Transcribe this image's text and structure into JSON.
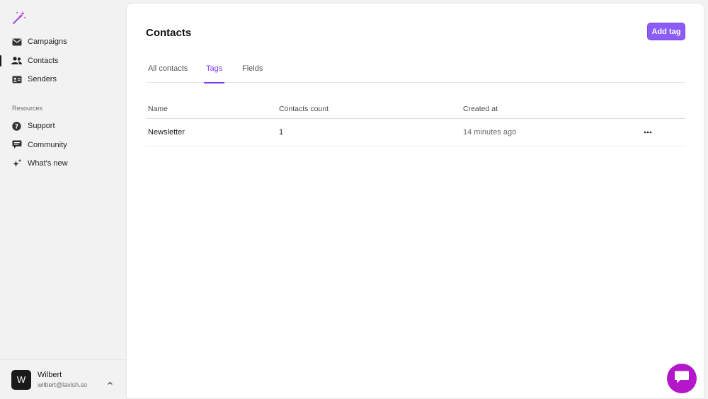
{
  "sidebar": {
    "items": [
      {
        "label": "Campaigns",
        "icon": "envelope-icon"
      },
      {
        "label": "Contacts",
        "icon": "users-icon",
        "active": true
      },
      {
        "label": "Senders",
        "icon": "id-card-icon"
      }
    ],
    "resources_label": "Resources",
    "resources": [
      {
        "label": "Support",
        "icon": "question-circle-icon"
      },
      {
        "label": "Community",
        "icon": "chat-icon"
      },
      {
        "label": "What's new",
        "icon": "sparkles-icon"
      }
    ]
  },
  "user": {
    "initial": "W",
    "name": "Wilbert",
    "email": "wilbert@lavish.so"
  },
  "header": {
    "title": "Contacts",
    "add_button": "Add tag"
  },
  "tabs": [
    {
      "label": "All contacts"
    },
    {
      "label": "Tags",
      "active": true
    },
    {
      "label": "Fields"
    }
  ],
  "table": {
    "columns": [
      "Name",
      "Contacts count",
      "Created at"
    ],
    "rows": [
      {
        "name": "Newsletter",
        "count": "1",
        "created": "14 minutes ago"
      }
    ]
  },
  "colors": {
    "accent": "#8b5cf6",
    "tab_active": "#7c3aed",
    "chat_bubble": "#b317c9"
  }
}
